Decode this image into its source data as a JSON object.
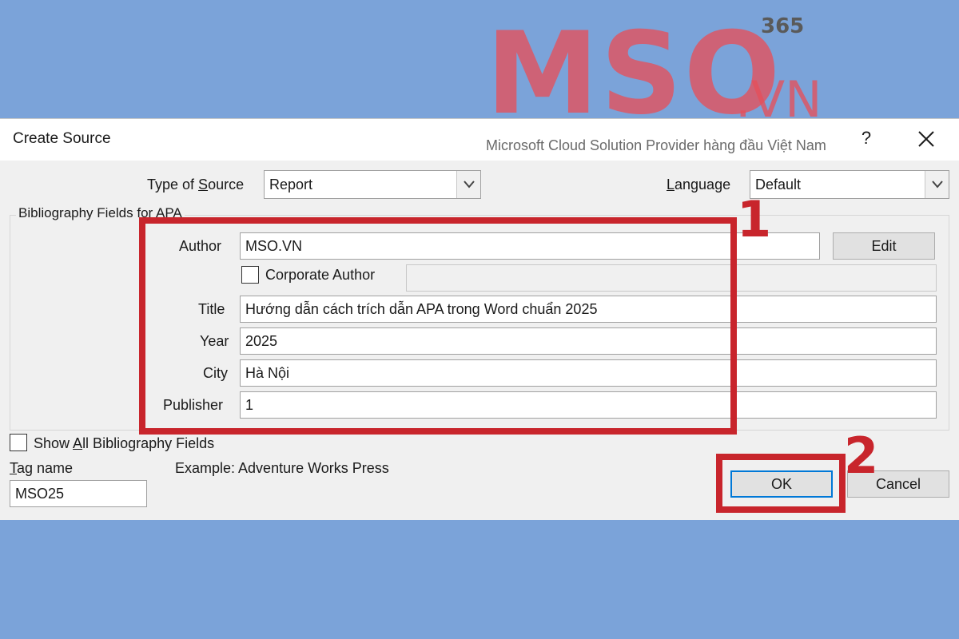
{
  "window": {
    "title": "Create Source",
    "help_label": "?"
  },
  "source_type": {
    "label_before": "Type of ",
    "label_key": "S",
    "label_after": "ource",
    "value": "Report"
  },
  "language": {
    "label_key": "L",
    "label_after": "anguage",
    "value": "Default"
  },
  "group": {
    "title": "Bibliography Fields for APA"
  },
  "fields": {
    "author_label": "Author",
    "author_value": "MSO.VN",
    "edit_label": "Edit",
    "corporate_label": "Corporate Author",
    "title_label": "Title",
    "title_value": "Hướng dẫn cách trích dẫn APA trong Word chuẩn 2025",
    "year_label": "Year",
    "year_value": "2025",
    "city_label": "City",
    "city_value": "Hà Nội",
    "publisher_label": "Publisher",
    "publisher_value": "1"
  },
  "footer": {
    "show_all_before": "Show ",
    "show_all_key": "A",
    "show_all_after": "ll Bibliography Fields",
    "tag_key": "T",
    "tag_after": "ag name",
    "tag_value": "MSO25",
    "example": "Example: Adventure Works Press",
    "ok_label": "OK",
    "cancel_label": "Cancel"
  },
  "annotations": {
    "step1": "1",
    "step2": "2",
    "color": "#c8252c"
  },
  "watermark": {
    "brand": "MSO",
    "domain": ".VN",
    "superscript": "365",
    "tagline": "Microsoft Cloud Solution Provider hàng đầu Việt Nam"
  }
}
